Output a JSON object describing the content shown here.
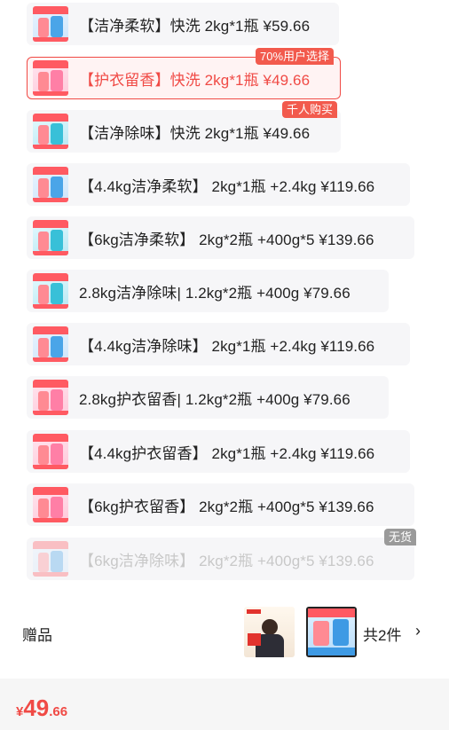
{
  "sku_options": [
    {
      "label": "【洁净柔软】快洗 2kg*1瓶  ¥59.66",
      "badge": "",
      "state": "normal",
      "thumb": "bottles-thumbnail"
    },
    {
      "label": "【护衣留香】快洗 2kg*1瓶  ¥49.66",
      "badge": "70%用户选择",
      "state": "selected",
      "thumb": "bottles-thumbnail"
    },
    {
      "label": "【洁净除味】快洗 2kg*1瓶  ¥49.66",
      "badge": "千人购买",
      "state": "normal",
      "thumb": "bottles-thumbnail"
    },
    {
      "label": "【4.4kg洁净柔软】 2kg*1瓶 +2.4kg  ¥119.66",
      "badge": "",
      "state": "normal",
      "thumb": "bottles-thumbnail"
    },
    {
      "label": "【6kg洁净柔软】 2kg*2瓶 +400g*5  ¥139.66",
      "badge": "",
      "state": "normal",
      "thumb": "bottles-thumbnail"
    },
    {
      "label": "2.8kg洁净除味| 1.2kg*2瓶 +400g  ¥79.66",
      "badge": "",
      "state": "normal",
      "thumb": "bottles-thumbnail"
    },
    {
      "label": "【4.4kg洁净除味】 2kg*1瓶 +2.4kg  ¥119.66",
      "badge": "",
      "state": "normal",
      "thumb": "bottles-thumbnail"
    },
    {
      "label": "2.8kg护衣留香| 1.2kg*2瓶 +400g  ¥79.66",
      "badge": "",
      "state": "normal",
      "thumb": "bottles-thumbnail"
    },
    {
      "label": "【4.4kg护衣留香】 2kg*1瓶 +2.4kg  ¥119.66",
      "badge": "",
      "state": "normal",
      "thumb": "bottles-thumbnail"
    },
    {
      "label": "【6kg护衣留香】 2kg*2瓶 +400g*5  ¥139.66",
      "badge": "",
      "state": "normal",
      "thumb": "bottles-thumbnail"
    },
    {
      "label": "【6kg洁净除味】 2kg*2瓶 +400g*5  ¥139.66",
      "badge": "无货",
      "state": "disabled",
      "thumb": "bottles-thumbnail"
    }
  ],
  "gift": {
    "label": "赠品",
    "count_text": "共2件",
    "chevron": "›",
    "images": [
      "gift-image-spokesperson",
      "gift-image-bottles"
    ]
  },
  "price": {
    "currency": "¥",
    "integer": "49",
    "decimal": ".66"
  },
  "colors": {
    "accent": "#f04a45",
    "badge": "#f25a4d",
    "out_of_stock_badge": "#9a9a9a",
    "option_bg": "#f6f6f8",
    "selected_bg": "#fff3f3"
  }
}
